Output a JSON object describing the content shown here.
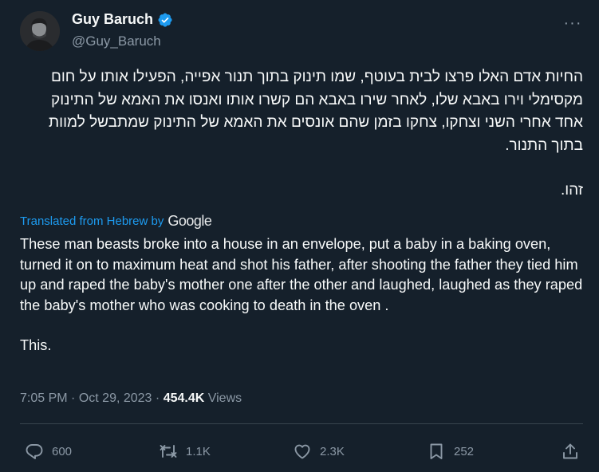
{
  "author": {
    "display_name": "Guy Baruch",
    "handle": "@Guy_Baruch",
    "verified": true
  },
  "more_label": "···",
  "original_text": {
    "paragraph_1": "החיות אדם האלו פרצו לבית בעוטף, שמו תינוק בתוך תנור אפייה, הפעילו אותו על חום מקסימלי וירו באבא שלו, לאחר שירו באבא הם קשרו אותו ואנסו את האמא של התינוק אחד אחרי השני וצחקו, צחקו בזמן שהם אונסים את האמא של התינוק שמתבשל למוות בתוך התנור.",
    "paragraph_2": "זהו."
  },
  "translation": {
    "label": "Translated from Hebrew by",
    "provider": "Google",
    "paragraph_1": "These man beasts broke into a house in an envelope, put a baby in a baking oven, turned it on to maximum heat and shot his father, after shooting the father they tied him up and raped the baby's mother one after the other and laughed, laughed as they raped the baby's mother who was cooking to death in the oven .",
    "paragraph_2": "This."
  },
  "meta": {
    "time": "7:05 PM",
    "separator": "·",
    "date": "Oct 29, 2023",
    "views_count": "454.4K",
    "views_label": "Views"
  },
  "actions": {
    "reply_count": "600",
    "retweet_count": "1.1K",
    "like_count": "2.3K",
    "bookmark_count": "252"
  },
  "icons": {
    "reply": "reply-icon",
    "retweet": "retweet-icon",
    "like": "heart-icon",
    "bookmark": "bookmark-icon",
    "share": "share-icon",
    "verified": "verified-badge-icon"
  },
  "colors": {
    "background": "#15202b",
    "text": "#f7f9f9",
    "secondary": "#8b98a5",
    "link": "#1d9bf0",
    "divider": "#38444d"
  }
}
